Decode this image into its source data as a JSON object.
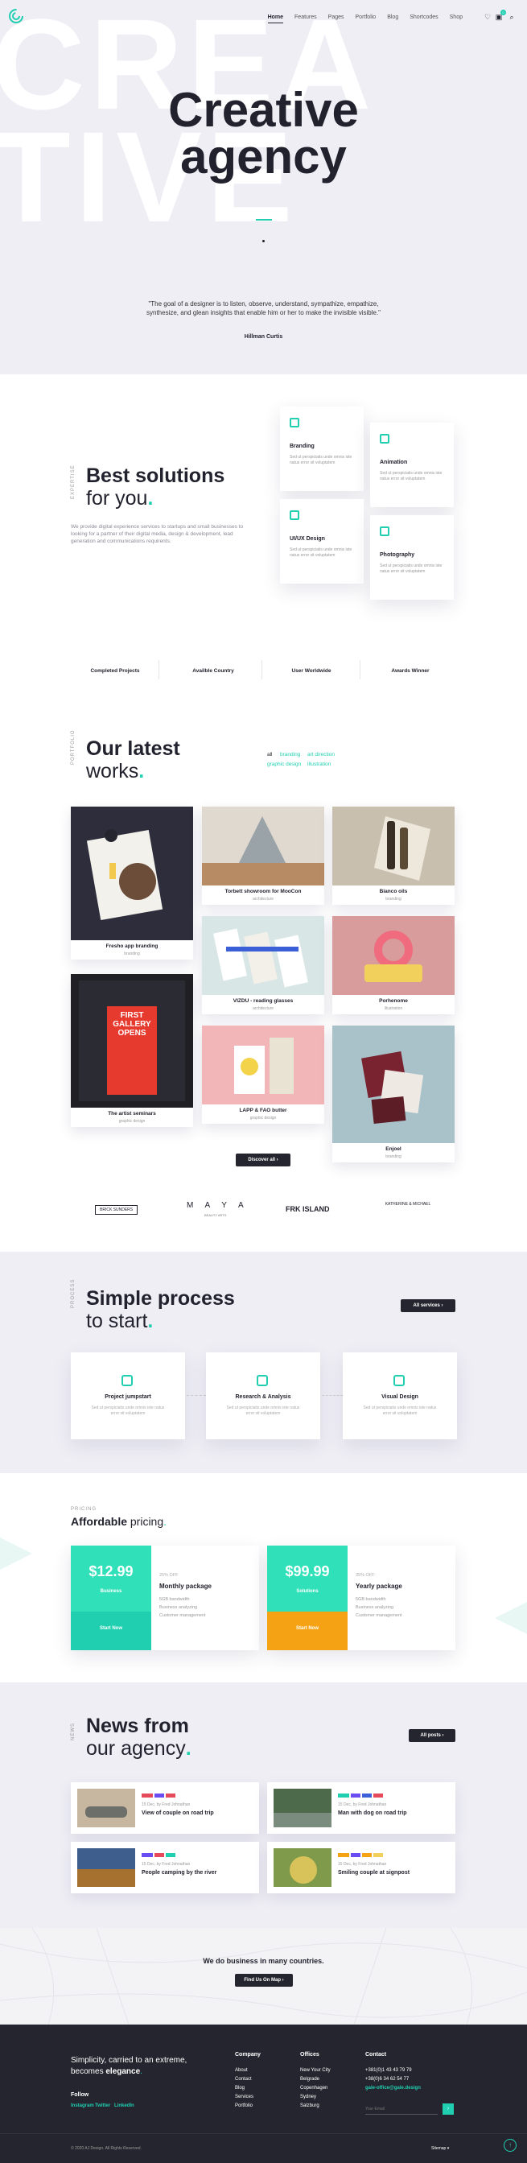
{
  "nav": {
    "items": [
      "Home",
      "Features",
      "Pages",
      "Portfolio",
      "Blog",
      "Shortcodes",
      "Shop"
    ],
    "cart_count": "0",
    "colors": {
      "accent": "#1fcfb0",
      "dark": "#25252f",
      "hero_bg": "#efeef5",
      "orange": "#f5a314"
    }
  },
  "hero": {
    "bg_word_1": "CREA",
    "bg_word_2": "TIVE",
    "title_1": "Creative",
    "title_2": "agency",
    "quote": "\"The goal of a designer is to listen, observe, understand, sympathize, empathize, synthesize, and glean insights that enable him or her to make the invisible visible.\"",
    "author": "Hillman Curtis"
  },
  "solutions": {
    "tag": "EXPERTISE",
    "title_1": "Best solutions",
    "title_2": "for you",
    "text": "We provide digital experience services to startups and small businesses to looking for a partner of their digital media, design & development, lead generation and communications requirents.",
    "cards": [
      {
        "title": "Branding",
        "text": "Sed ut perspiciatis unde omnis iste natus error sit voluptatem"
      },
      {
        "title": "Animation",
        "text": "Sed ut perspiciatis unde omnis iste natus error sit voluptatem"
      },
      {
        "title": "UI/UX Design",
        "text": "Sed ut perspiciatis unde omnis iste natus error sit voluptatem"
      },
      {
        "title": "Photography",
        "text": "Sed ut perspiciatis unde omnis iste natus error sit voluptatem"
      }
    ],
    "stats": [
      "Completed Projects",
      "Availble Country",
      "User Worldwide",
      "Awards Winner"
    ]
  },
  "works": {
    "tag": "PORTFOLIO",
    "title_1": "Our latest",
    "title_2": "works",
    "filters": [
      "all",
      "branding",
      "art direction",
      "graphic design",
      "illustration"
    ],
    "items": [
      {
        "title": "Fresho app branding",
        "sub": "branding"
      },
      {
        "title": "Torbett showroom for MooCon",
        "sub": "architecture"
      },
      {
        "title": "Bianco oils",
        "sub": "branding"
      },
      {
        "title": "VIZDU - reading glasses",
        "sub": "architecture"
      },
      {
        "title": "Porhenome",
        "sub": "illustration"
      },
      {
        "title": "The artist seminars",
        "sub": "graphic design"
      },
      {
        "title": "LAPP & FAO butter",
        "sub": "graphic design"
      },
      {
        "title": "Enjoel",
        "sub": "branding"
      }
    ],
    "discover": "Discover all",
    "logos": [
      "BRICK SUNDERS",
      "M A Y A",
      "FRK ISLAND",
      "KATHERINE & MICHAEL"
    ],
    "maya_sub": "BEAUTY ARTS",
    "gallery_text": "FIRST GALLERY OPENS"
  },
  "process": {
    "tag": "PROCESS",
    "title_1": "Simple process",
    "title_2": "to start",
    "button": "All services",
    "steps": [
      {
        "title": "Project jumpstart",
        "text": "Sed ut perspiciatis unde omnis iste natus error sit voluptatem"
      },
      {
        "title": "Research & Analysis",
        "text": "Sed ut perspiciatis unde omnis iste natus error sit voluptatem"
      },
      {
        "title": "Visual Design",
        "text": "Sed ut perspiciatis unde omnis iste natus error sit voluptatem"
      }
    ]
  },
  "pricing": {
    "tag": "PRICING",
    "title_1": "Affordable",
    "title_2": "pricing",
    "plans": [
      {
        "price": "$12.99",
        "level": "Business",
        "off": "25% OFF",
        "name": "Monthly package",
        "features": [
          "5GB bandwidth",
          "Business analyzing",
          "Customer management"
        ],
        "button": "Start Now"
      },
      {
        "price": "$99.99",
        "level": "Solutions",
        "off": "35% OFF",
        "name": "Yearly package",
        "features": [
          "5GB bandwidth",
          "Business analyzing",
          "Customer management"
        ],
        "button": "Start Now"
      }
    ]
  },
  "news": {
    "tag": "NEWS",
    "title_1": "News from",
    "title_2": "our agency",
    "button": "All posts",
    "items": [
      {
        "date": "15 Dec, by Fred Johnathan",
        "title": "View of couple on road trip"
      },
      {
        "date": "15 Dec, by Fred Johnathan",
        "title": "Man with dog on road trip"
      },
      {
        "date": "15 Dec, by Fred Johnathan",
        "title": "People camping by the river"
      },
      {
        "date": "15 Dec, by Fred Johnathan",
        "title": "Smiling couple at signpost"
      }
    ]
  },
  "map": {
    "text": "We do business in many countries.",
    "button": "Find Us On Map"
  },
  "footer": {
    "slogan_1": "Simplicity, carried to an extreme,",
    "slogan_2": "becomes",
    "slogan_3": "elegance",
    "follow": "Follow",
    "social": [
      "Instagram",
      "Twitter",
      "LinkedIn"
    ],
    "company_title": "Company",
    "company": [
      "About",
      "Contact",
      "Blog",
      "Services",
      "Portfolio"
    ],
    "offices_title": "Offices",
    "offices": [
      "New Your City",
      "Belgrade",
      "Copenhagen",
      "Sydney",
      "Salzburg"
    ],
    "contact_title": "Contact",
    "phones": [
      "+381(0)1 43 43 79 79",
      "+38(0)6 34 62 54 77"
    ],
    "email": "gale-office@gale.design",
    "email_placeholder": "Your Email",
    "copyright": "© 2020 AJ Design. All Rights Reserved.",
    "sitemap": "Sitemap"
  }
}
